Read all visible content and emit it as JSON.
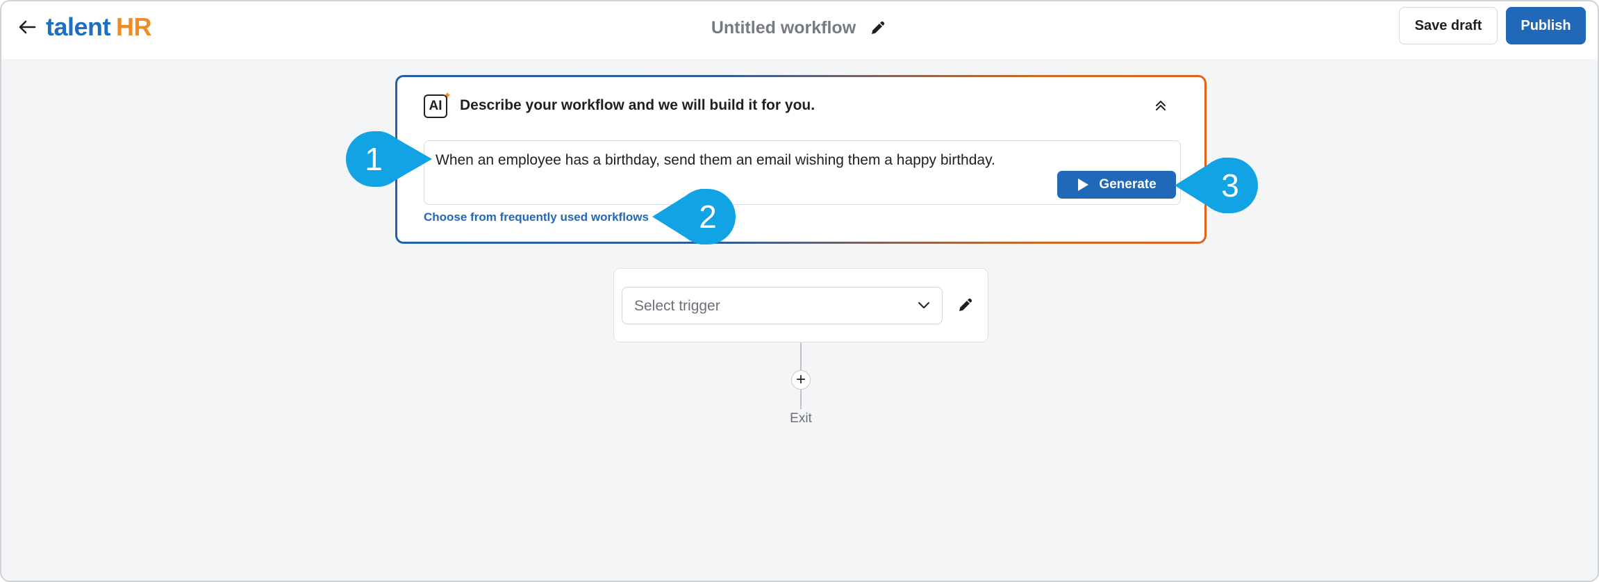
{
  "header": {
    "logo_primary": "talent",
    "logo_secondary": "HR",
    "workflow_title": "Untitled workflow",
    "save_draft_label": "Save draft",
    "publish_label": "Publish"
  },
  "ai_panel": {
    "badge_text": "AI",
    "heading": "Describe your workflow and we will build it for you.",
    "prompt_value": "When an employee has a birthday, send them an email wishing them a happy birthday.",
    "generate_label": "Generate",
    "frequent_workflows_link": "Choose from frequently used workflows"
  },
  "trigger": {
    "placeholder": "Select trigger"
  },
  "flow": {
    "add_symbol": "+",
    "exit_label": "Exit"
  },
  "callouts": [
    "1",
    "2",
    "3"
  ],
  "colors": {
    "primary_blue": "#2169b8",
    "logo_orange": "#f08a24",
    "callout_blue": "#12a3e4",
    "background": "#f4f5f7"
  },
  "icons": {
    "back": "arrow-left-icon",
    "edit": "pencil-icon",
    "collapse": "double-chevron-up-icon",
    "play": "play-icon",
    "dropdown": "chevron-down-icon"
  }
}
